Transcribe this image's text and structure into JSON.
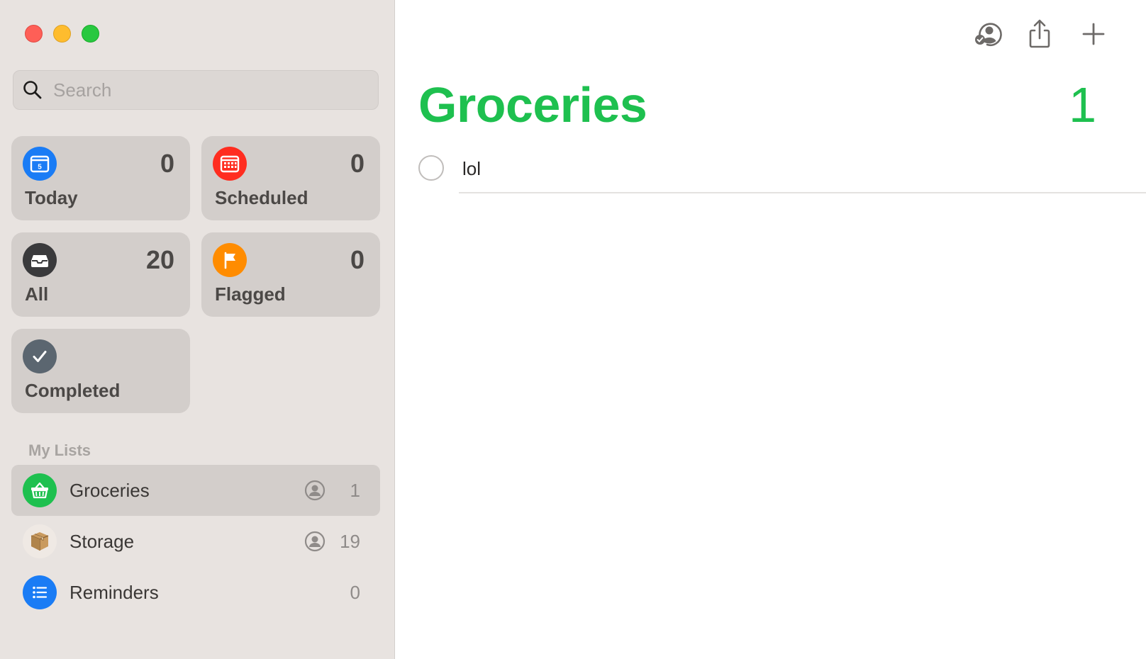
{
  "search": {
    "placeholder": "Search"
  },
  "smart_lists": [
    {
      "id": "today",
      "label": "Today",
      "count": "0",
      "icon": "calendar-icon",
      "icon_text": "5",
      "color": "#1a7cf5"
    },
    {
      "id": "scheduled",
      "label": "Scheduled",
      "count": "0",
      "icon": "calendar-grid-icon",
      "color": "#ff2d20"
    },
    {
      "id": "all",
      "label": "All",
      "count": "20",
      "icon": "tray-icon",
      "color": "#3a3a3c"
    },
    {
      "id": "flagged",
      "label": "Flagged",
      "count": "0",
      "icon": "flag-icon",
      "color": "#ff8c00"
    },
    {
      "id": "completed",
      "label": "Completed",
      "count": "",
      "icon": "checkmark-icon",
      "color": "#5b6670"
    }
  ],
  "my_lists": {
    "header": "My Lists",
    "items": [
      {
        "name": "Groceries",
        "count": "1",
        "shared": true,
        "icon": "basket-icon",
        "color": "#1ec04f",
        "selected": true
      },
      {
        "name": "Storage",
        "count": "19",
        "shared": true,
        "icon": "package-icon",
        "color": "#efe9e4",
        "selected": false
      },
      {
        "name": "Reminders",
        "count": "0",
        "shared": false,
        "icon": "list-bullet-icon",
        "color": "#1a7cf5",
        "selected": false
      }
    ]
  },
  "main": {
    "title": "Groceries",
    "total": "1",
    "title_color": "#1ec04f",
    "reminders": [
      {
        "text": "lol",
        "completed": false
      }
    ]
  },
  "toolbar": {
    "buttons": [
      "shared-with-icon",
      "share-icon",
      "add-icon"
    ]
  }
}
